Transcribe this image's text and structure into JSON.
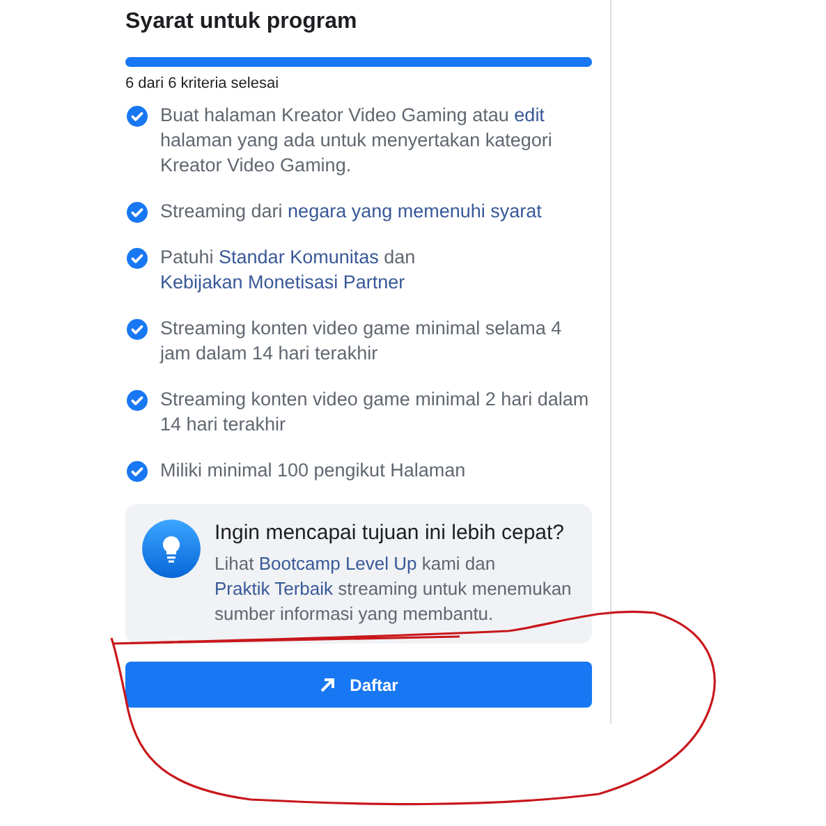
{
  "title": "Syarat untuk program",
  "progress": {
    "level": 1,
    "label": "6 dari 6 kriteria selesai"
  },
  "criteria": [
    {
      "checked": true,
      "segments": [
        {
          "text": "Buat halaman Kreator Video Gaming atau ",
          "link": false
        },
        {
          "text": "edit",
          "link": true
        },
        {
          "text": " halaman yang ada untuk menyertakan kategori Kreator Video Gaming.",
          "link": false
        }
      ]
    },
    {
      "checked": true,
      "segments": [
        {
          "text": "Streaming dari ",
          "link": false
        },
        {
          "text": "negara yang memenuhi syarat",
          "link": true
        }
      ]
    },
    {
      "checked": true,
      "segments": [
        {
          "text": "Patuhi ",
          "link": false
        },
        {
          "text": "Standar Komunitas",
          "link": true
        },
        {
          "text": " dan ",
          "link": false
        },
        {
          "text": "Kebijakan ",
          "link": true
        },
        {
          "text": "Monetisasi Partner",
          "link": true
        }
      ]
    },
    {
      "checked": true,
      "segments": [
        {
          "text": "Streaming konten video game minimal selama 4 jam dalam 14 hari terakhir",
          "link": false
        }
      ]
    },
    {
      "checked": true,
      "segments": [
        {
          "text": "Streaming konten video game minimal 2 hari dalam 14 hari terakhir",
          "link": false
        }
      ]
    },
    {
      "checked": true,
      "segments": [
        {
          "text": "Miliki minimal 100 pengikut Halaman",
          "link": false
        }
      ]
    }
  ],
  "tip": {
    "title": "Ingin mencapai tujuan ini lebih cepat?",
    "segments": [
      {
        "text": "Lihat ",
        "link": false
      },
      {
        "text": "Bootcamp Level Up",
        "link": true
      },
      {
        "text": " kami dan ",
        "link": false
      },
      {
        "text": "Praktik ",
        "link": true
      },
      {
        "text": "Terbaik",
        "link": true
      },
      {
        "text": " streaming untuk menemukan sumber informasi yang membantu.",
        "link": false
      }
    ]
  },
  "button": {
    "label": "Daftar"
  }
}
